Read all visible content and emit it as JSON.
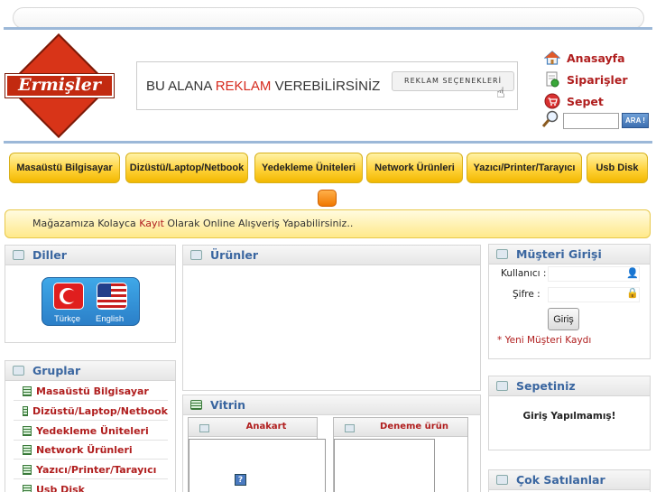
{
  "header": {
    "logo_text": "Ermişler",
    "ad": {
      "text_part1": "BU ALANA ",
      "text_highlight": "REKLAM",
      "text_part2": " VEREBİLİRSİNİZ",
      "button": "REKLAM SEÇENEKLERİ"
    },
    "links": [
      {
        "label": "Anasayfa",
        "icon": "home-icon"
      },
      {
        "label": "Siparişler",
        "icon": "orders-icon"
      },
      {
        "label": "Sepet",
        "icon": "cart-icon"
      }
    ],
    "search": {
      "button": "ARA !",
      "value": ""
    }
  },
  "nav": [
    "Masaüstü Bilgisayar",
    "Dizüstü/Laptop/Netbook",
    "Yedekleme Üniteleri",
    "Network Ürünleri",
    "Yazıcı/Printer/Tarayıcı",
    "Usb Disk"
  ],
  "welcome": {
    "part1": "Mağazamıza Kolayca ",
    "link": "Kayıt",
    "part2": " Olarak Online Alışveriş Yapabilirsiniz.."
  },
  "languages": {
    "title": "Diller",
    "items": [
      "Türkçe",
      "English"
    ]
  },
  "groups": {
    "title": "Gruplar",
    "items": [
      "Masaüstü Bilgisayar",
      "Dizüstü/Laptop/Netbook",
      "Yedekleme Üniteleri",
      "Network Ürünleri",
      "Yazıcı/Printer/Tarayıcı",
      "Usb Disk"
    ]
  },
  "products": {
    "title": "Ürünler"
  },
  "vitrin": {
    "title": "Vitrin",
    "items": [
      "Anakart",
      "Deneme ürün"
    ]
  },
  "login": {
    "title": "Müşteri Girişi",
    "username_label": "Kullanıcı :",
    "password_label": "Şifre :",
    "button": "Giriş",
    "register_link": "* Yeni Müşteri Kaydı"
  },
  "cart": {
    "title": "Sepetiniz",
    "status": "Giriş Yapılmamış!"
  },
  "bestsellers": {
    "title": "Çok Satılanlar"
  }
}
